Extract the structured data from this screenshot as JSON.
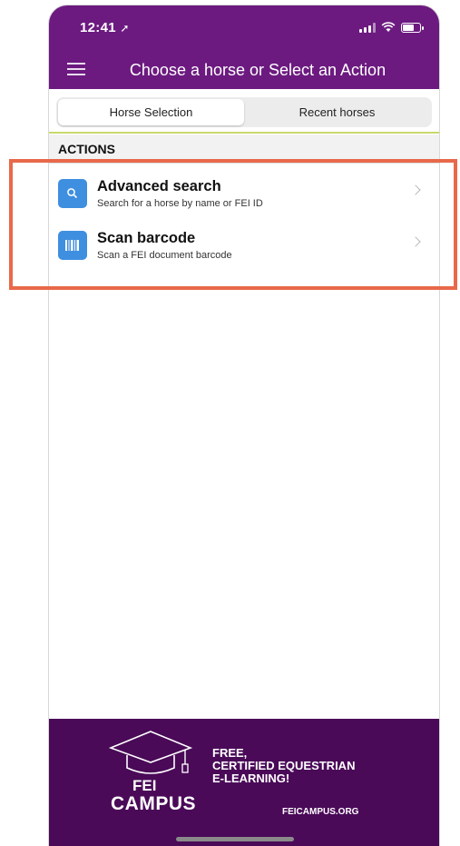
{
  "status_bar": {
    "time": "12:41"
  },
  "nav": {
    "title": "Choose a horse or Select an Action",
    "menu_icon": "hamburger-icon"
  },
  "tabs": [
    {
      "label": "Horse Selection",
      "active": true
    },
    {
      "label": "Recent horses",
      "active": false
    }
  ],
  "section": {
    "title": "ACTIONS"
  },
  "actions": [
    {
      "title": "Advanced search",
      "subtitle": "Search for a horse by name or FEI ID",
      "icon": "search-icon"
    },
    {
      "title": "Scan barcode",
      "subtitle": "Scan a FEI document barcode",
      "icon": "barcode-icon"
    }
  ],
  "banner": {
    "lines": [
      "FREE,",
      "CERTIFIED EQUESTRIAN",
      "E-LEARNING!"
    ],
    "logo_top": "FEI",
    "logo_bottom": "CAMPUS",
    "url": "FEICAMPUS.ORG"
  },
  "colors": {
    "header": "#6c1a80",
    "banner": "#4a0a58",
    "accent": "#3f8fe0",
    "highlight": "#e8694a",
    "divider": "#c9d86a"
  }
}
